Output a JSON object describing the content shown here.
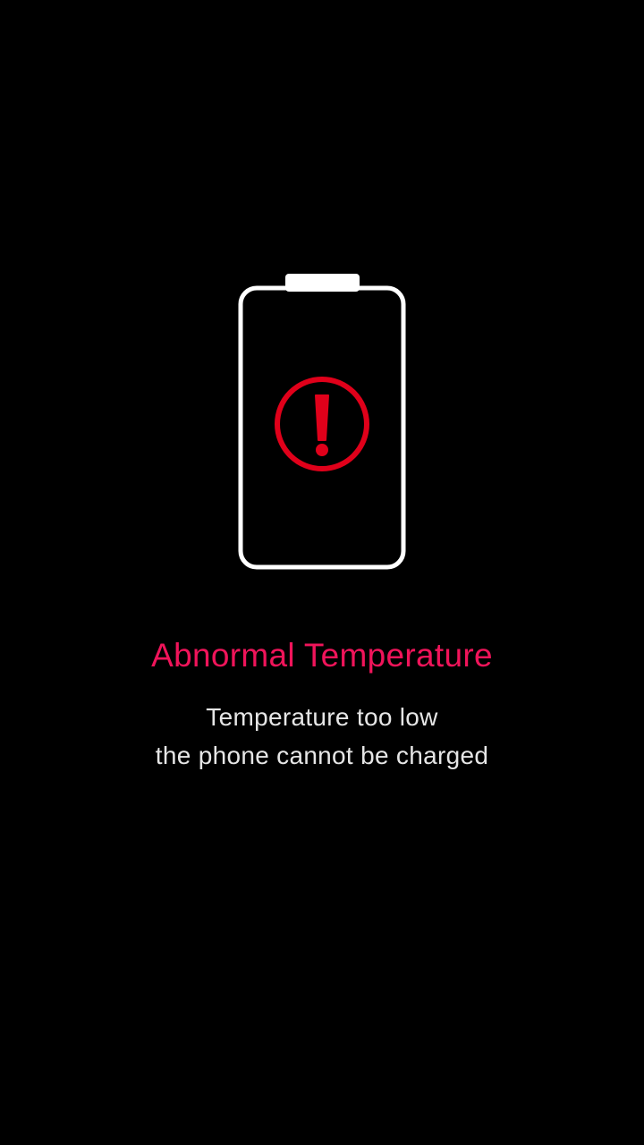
{
  "colors": {
    "background": "#000000",
    "battery_outline": "#ffffff",
    "warning_icon": "#e0001a",
    "title_text": "#f0145a",
    "message_text": "#e6e6e6"
  },
  "icons": {
    "battery": "battery-outline-icon",
    "warning": "exclamation-circle-icon"
  },
  "alert": {
    "title": "Abnormal Temperature",
    "message_line1": "Temperature too low",
    "message_line2": "the phone cannot be charged"
  }
}
